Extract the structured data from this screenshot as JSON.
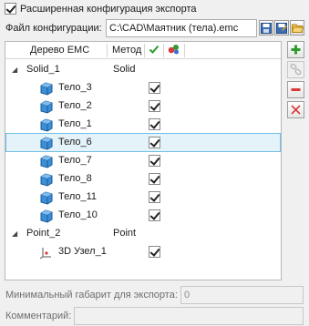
{
  "export": {
    "extended_config_label": "Расширенная конфигурация экспорта",
    "extended_config_checked": true
  },
  "config_file": {
    "label": "Файл конфигурации:",
    "value": "C:\\CAD\\Маятник (тела).emc",
    "buttons": [
      "save-icon",
      "save-as-icon",
      "open-folder-icon"
    ]
  },
  "tree": {
    "columns": {
      "tree": "Дерево ЕМС",
      "method": "Метод",
      "check_icon": "green-check-icon",
      "color_icon": "color-balls-icon"
    },
    "groups": [
      {
        "label": "Solid_1",
        "method": "Solid",
        "items": [
          {
            "label": "Тело_3",
            "checked": true,
            "icon": "cube-icon"
          },
          {
            "label": "Тело_2",
            "checked": true,
            "icon": "cube-icon"
          },
          {
            "label": "Тело_1",
            "checked": true,
            "icon": "cube-icon"
          },
          {
            "label": "Тело_6",
            "checked": true,
            "icon": "cube-icon",
            "selected": true
          },
          {
            "label": "Тело_7",
            "checked": true,
            "icon": "cube-icon"
          },
          {
            "label": "Тело_8",
            "checked": true,
            "icon": "cube-icon"
          },
          {
            "label": "Тело_11",
            "checked": true,
            "icon": "cube-icon"
          },
          {
            "label": "Тело_10",
            "checked": true,
            "icon": "cube-icon"
          }
        ]
      },
      {
        "label": "Point_2",
        "method": "Point",
        "items": [
          {
            "label": "3D Узел_1",
            "checked": true,
            "icon": "node-3d-icon"
          }
        ]
      }
    ]
  },
  "side_buttons": [
    {
      "name": "add-button",
      "icon": "plus-icon",
      "enabled": true
    },
    {
      "name": "link-button",
      "icon": "chain-link-icon",
      "enabled": false
    },
    {
      "name": "remove-button",
      "icon": "minus-icon",
      "enabled": true
    },
    {
      "name": "delete-button",
      "icon": "red-x-icon",
      "enabled": true
    }
  ],
  "min_size": {
    "label": "Минимальный габарит для экспорта:",
    "value": "0"
  },
  "comment": {
    "label": "Комментарий:",
    "value": ""
  },
  "colors": {
    "accent_green": "#2e9b2e",
    "remove_red": "#d83a3a",
    "cube_blue": "#3b8fd6",
    "selection_bg": "#e4f2f9",
    "selection_border": "#70c0e7"
  }
}
